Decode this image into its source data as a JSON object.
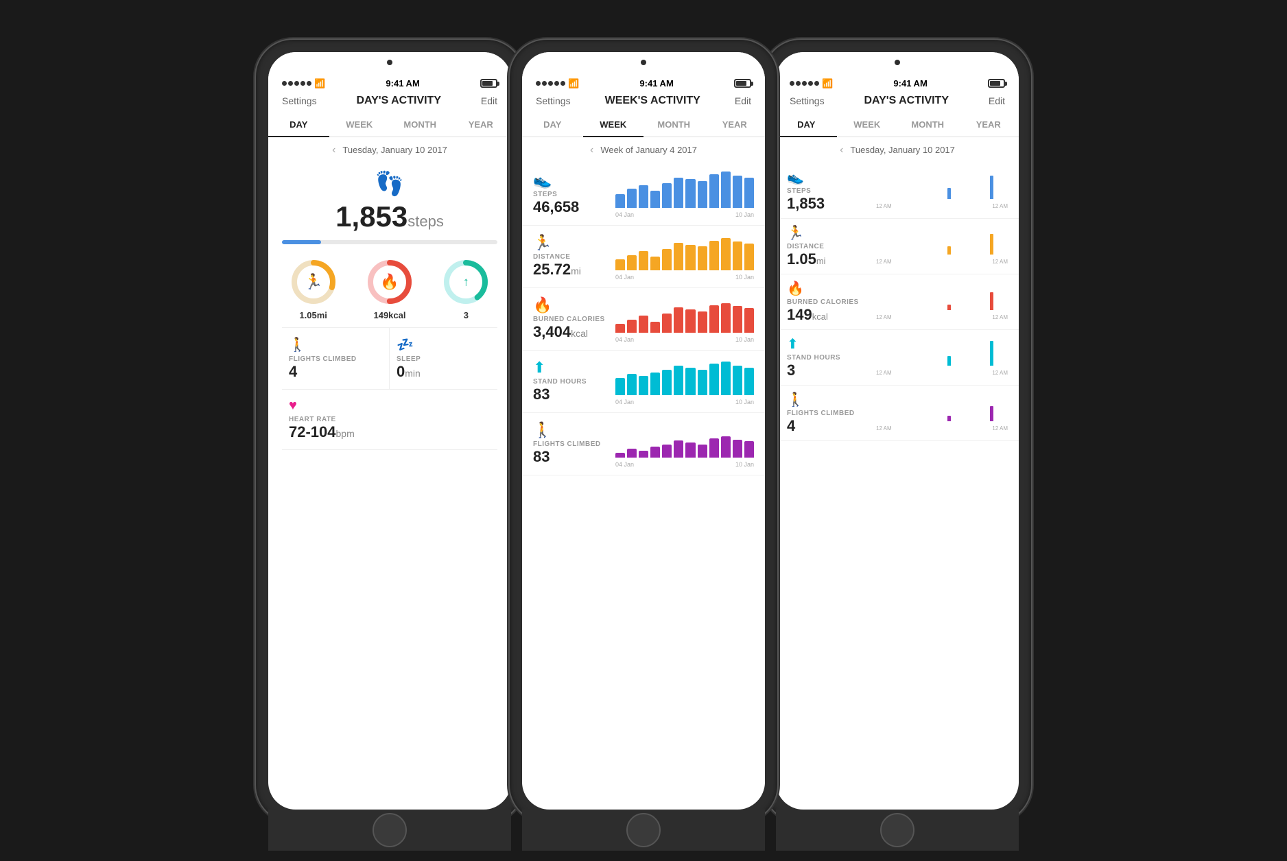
{
  "phone1": {
    "statusBar": {
      "dots": 5,
      "wifi": "wifi",
      "time": "9:41 AM",
      "battery": "battery"
    },
    "nav": {
      "settings": "Settings",
      "title": "DAY'S ACTIVITY",
      "edit": "Edit"
    },
    "tabs": [
      "DAY",
      "WEEK",
      "MONTH",
      "YEAR"
    ],
    "activeTab": 0,
    "date": "Tuesday, January 10 2017",
    "steps": "1,853",
    "stepsUnit": "steps",
    "progressPercent": 18,
    "rings": [
      {
        "label": "1.05mi",
        "unit": "",
        "color": "#f5a623",
        "icon": "🏃",
        "percent": 30
      },
      {
        "label": "149kcal",
        "unit": "",
        "color": "#e74c3c",
        "icon": "🔥",
        "percent": 50
      },
      {
        "label": "3",
        "unit": "",
        "color": "#1abc9c",
        "icon": "↑",
        "percent": 40
      }
    ],
    "stats": [
      {
        "icon": "flights_climbed",
        "label": "FLIGHTS CLIMBED",
        "value": "4",
        "unit": "",
        "color": "#c0392b"
      },
      {
        "icon": "sleep",
        "label": "SLEEP",
        "value": "0",
        "unit": "min",
        "color": "#7b68ee"
      }
    ],
    "heartRate": {
      "icon": "heart_rate",
      "label": "HEART RATE",
      "value": "72-104",
      "unit": "bpm",
      "color": "#e91e8c"
    }
  },
  "phone2": {
    "nav": {
      "settings": "Settings",
      "title": "WEEK'S ACTIVITY",
      "edit": "Edit"
    },
    "tabs": [
      "DAY",
      "WEEK",
      "MONTH",
      "YEAR"
    ],
    "activeTab": 1,
    "date": "Week of January 4 2017",
    "metrics": [
      {
        "icon": "steps",
        "label": "STEPS",
        "value": "46,658",
        "unit": "",
        "color": "#4a90e2",
        "bars": [
          30,
          45,
          55,
          40,
          60,
          75,
          70,
          65,
          80,
          85,
          78,
          72
        ],
        "dateStart": "04 Jan",
        "dateEnd": "10 Jan"
      },
      {
        "icon": "distance",
        "label": "DISTANCE",
        "value": "25.72",
        "unit": "mi",
        "color": "#f5a623",
        "bars": [
          25,
          35,
          45,
          30,
          50,
          65,
          60,
          55,
          70,
          75,
          68,
          62
        ],
        "dateStart": "04 Jan",
        "dateEnd": "10 Jan"
      },
      {
        "icon": "calories",
        "label": "BURNED CALORIES",
        "value": "3,404",
        "unit": "kcal",
        "color": "#e74c3c",
        "bars": [
          20,
          30,
          40,
          25,
          45,
          60,
          55,
          50,
          65,
          70,
          63,
          58
        ],
        "dateStart": "04 Jan",
        "dateEnd": "10 Jan"
      },
      {
        "icon": "stand",
        "label": "STAND HOURS",
        "value": "83",
        "unit": "",
        "color": "#00bcd4",
        "bars": [
          40,
          50,
          45,
          55,
          60,
          70,
          65,
          60,
          75,
          80,
          70,
          65
        ],
        "dateStart": "04 Jan",
        "dateEnd": "10 Jan"
      },
      {
        "icon": "flights",
        "label": "FLIGHTS CLIMBED",
        "value": "83",
        "unit": "",
        "color": "#9c27b0",
        "bars": [
          10,
          20,
          15,
          25,
          30,
          40,
          35,
          30,
          45,
          50,
          42,
          38
        ],
        "dateStart": "04 Jan",
        "dateEnd": "10 Jan"
      }
    ]
  },
  "phone3": {
    "nav": {
      "settings": "Settings",
      "title": "DAY'S ACTIVITY",
      "edit": "Edit"
    },
    "tabs": [
      "DAY",
      "WEEK",
      "MONTH",
      "YEAR"
    ],
    "activeTab": 0,
    "date": "Tuesday, January 10 2017",
    "metrics": [
      {
        "icon": "steps",
        "label": "STEPS",
        "value": "1,853",
        "unit": "",
        "color": "#4a90e2",
        "bars": [
          0,
          0,
          0,
          0,
          0,
          0,
          0,
          0,
          0,
          0,
          0,
          0,
          0,
          0,
          0,
          0,
          0,
          0,
          0,
          0,
          0,
          0,
          0,
          0,
          0,
          0,
          0,
          0,
          0,
          0,
          0,
          0,
          0,
          0,
          0,
          0,
          0,
          0,
          0,
          0,
          0,
          0,
          0,
          0,
          0,
          0,
          0,
          0,
          0,
          0,
          0,
          0,
          0,
          0,
          0,
          0,
          0,
          0,
          0,
          0,
          0,
          0,
          0,
          0,
          0,
          0,
          0,
          0,
          0,
          0,
          0,
          0,
          0,
          0,
          0,
          30,
          0,
          0,
          0,
          0,
          0,
          0,
          0,
          0,
          0,
          0,
          0,
          0,
          80,
          0,
          0,
          0,
          0,
          0,
          0,
          0,
          0,
          0,
          0,
          0
        ],
        "timeStart": "12 AM",
        "timeEnd": "12 AM"
      },
      {
        "icon": "distance",
        "label": "DISTANCE",
        "value": "1.05",
        "unit": "mi",
        "color": "#f5a623",
        "bars": [
          0,
          0,
          0,
          0,
          0,
          0,
          0,
          0,
          0,
          0,
          0,
          0,
          0,
          0,
          0,
          0,
          0,
          0,
          0,
          0,
          0,
          0,
          0,
          0,
          0,
          0,
          0,
          0,
          0,
          0,
          0,
          0,
          0,
          0,
          0,
          0,
          0,
          0,
          0,
          0,
          0,
          0,
          0,
          0,
          0,
          0,
          0,
          0,
          0,
          0,
          0,
          0,
          0,
          0,
          0,
          0,
          0,
          0,
          0,
          0,
          0,
          0,
          0,
          0,
          0,
          0,
          0,
          0,
          0,
          0,
          0,
          0,
          0,
          0,
          0,
          20,
          0,
          0,
          0,
          0,
          0,
          0,
          0,
          0,
          0,
          0,
          0,
          0,
          70,
          0,
          0,
          0,
          0,
          0,
          0,
          0,
          0,
          0,
          0,
          0
        ],
        "timeStart": "12 AM",
        "timeEnd": "12 AM"
      },
      {
        "icon": "calories",
        "label": "BURNED CALORIES",
        "value": "149",
        "unit": "kcal",
        "color": "#e74c3c",
        "bars": [
          0,
          0,
          0,
          0,
          0,
          0,
          0,
          0,
          0,
          0,
          0,
          0,
          0,
          0,
          0,
          0,
          0,
          0,
          0,
          0,
          0,
          0,
          0,
          0,
          0,
          0,
          0,
          0,
          0,
          0,
          0,
          0,
          0,
          0,
          0,
          0,
          0,
          0,
          0,
          0,
          0,
          0,
          0,
          0,
          0,
          0,
          0,
          0,
          0,
          0,
          0,
          0,
          0,
          0,
          0,
          0,
          0,
          0,
          0,
          0,
          0,
          0,
          0,
          0,
          0,
          0,
          0,
          0,
          0,
          0,
          0,
          0,
          0,
          0,
          0,
          15,
          0,
          0,
          0,
          0,
          0,
          0,
          0,
          0,
          0,
          0,
          0,
          0,
          60,
          0,
          0,
          0,
          0,
          0,
          0,
          0,
          0,
          0,
          0,
          0
        ],
        "timeStart": "12 AM",
        "timeEnd": "12 AM"
      },
      {
        "icon": "stand",
        "label": "STAND HOURS",
        "value": "3",
        "unit": "",
        "color": "#00bcd4",
        "bars": [
          0,
          0,
          0,
          0,
          0,
          0,
          0,
          0,
          0,
          0,
          0,
          0,
          0,
          0,
          0,
          0,
          0,
          0,
          0,
          0,
          0,
          0,
          0,
          0,
          0,
          0,
          0,
          0,
          0,
          0,
          0,
          0,
          0,
          0,
          0,
          0,
          0,
          0,
          0,
          0,
          0,
          0,
          0,
          0,
          0,
          0,
          0,
          0,
          0,
          0,
          0,
          0,
          0,
          0,
          0,
          0,
          0,
          0,
          0,
          0,
          0,
          0,
          0,
          0,
          0,
          0,
          0,
          0,
          0,
          0,
          0,
          0,
          0,
          0,
          0,
          25,
          0,
          0,
          0,
          0,
          0,
          0,
          0,
          0,
          0,
          0,
          0,
          0,
          80,
          0,
          0,
          0,
          0,
          0,
          0,
          0,
          0,
          0,
          0,
          0
        ],
        "timeStart": "12 AM",
        "timeEnd": "12 AM"
      },
      {
        "icon": "flights",
        "label": "FLIGHTS CLIMBED",
        "value": "4",
        "unit": "",
        "color": "#9c27b0",
        "bars": [
          0,
          0,
          0,
          0,
          0,
          0,
          0,
          0,
          0,
          0,
          0,
          0,
          0,
          0,
          0,
          0,
          0,
          0,
          0,
          0,
          0,
          0,
          0,
          0,
          0,
          0,
          0,
          0,
          0,
          0,
          0,
          0,
          0,
          0,
          0,
          0,
          0,
          0,
          0,
          0,
          0,
          0,
          0,
          0,
          0,
          0,
          0,
          0,
          0,
          0,
          0,
          0,
          0,
          0,
          0,
          0,
          0,
          0,
          0,
          0,
          0,
          0,
          0,
          0,
          0,
          0,
          0,
          0,
          0,
          0,
          0,
          0,
          0,
          0,
          0,
          15,
          0,
          0,
          0,
          0,
          0,
          0,
          0,
          0,
          0,
          0,
          0,
          0,
          50,
          0,
          0,
          0,
          0,
          0,
          0,
          0,
          0,
          0,
          0,
          0
        ],
        "timeStart": "12 AM",
        "timeEnd": "12 AM"
      }
    ]
  },
  "icons": {
    "steps": "👟",
    "distance": "🏃",
    "calories": "🔥",
    "stand": "⬆",
    "flights": "🚶",
    "sleep": "💤",
    "heart": "❤"
  }
}
